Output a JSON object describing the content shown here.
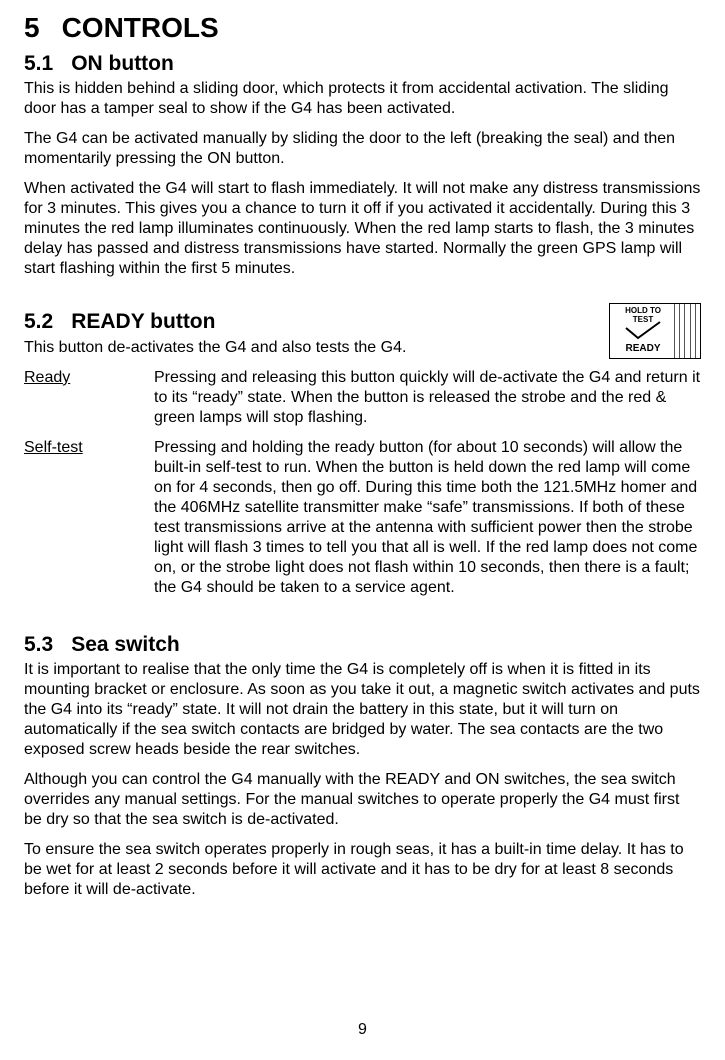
{
  "h1": {
    "num": "5",
    "title": "CONTROLS"
  },
  "s1": {
    "num": "5.1",
    "title": "ON button",
    "p1": "This is hidden behind a sliding door, which protects it from accidental activation. The sliding door has a tamper seal to show if the G4 has been activated.",
    "p2": "The G4 can be activated manually by sliding the door to the left (breaking the seal) and then momentarily pressing the ON button.",
    "p3": "When activated the G4 will start to flash immediately. It will not make any distress transmissions for 3 minutes. This gives you a chance to turn it off if you activated it accidentally. During this 3 minutes the red lamp illuminates continuously. When the red lamp starts to flash, the 3 minutes delay has passed and distress transmissions have started. Normally the green GPS lamp will start flashing within the first 5 minutes."
  },
  "s2": {
    "num": "5.2",
    "title": "READY button",
    "intro": "This button de-activates the G4 and also tests the G4.",
    "diagram": {
      "top": "HOLD TO TEST",
      "bottom": "READY"
    },
    "defs": [
      {
        "term": "Ready",
        "desc": "Pressing and releasing this button quickly will de-activate the G4 and return it to its “ready” state. When the button is released the strobe and the red & green lamps will stop flashing."
      },
      {
        "term": "Self-test",
        "desc": "Pressing and holding the ready button (for about 10 seconds) will allow the built-in self-test to run. When the button is held down the red lamp will come on for 4 seconds, then go off.  During this time both the 121.5MHz homer and the 406MHz satellite transmitter make “safe” transmissions. If both of these test transmissions arrive at the antenna with sufficient power then the strobe light will flash 3 times to tell you that all is well. If the red lamp does not come on, or the strobe light does not flash within 10 seconds, then there is a fault; the G4 should be taken to a service agent."
      }
    ]
  },
  "s3": {
    "num": "5.3",
    "title": "Sea switch",
    "p1": "It is important to realise that the only time the G4 is completely off is when it is fitted in its mounting bracket or enclosure. As soon as you take it out, a magnetic switch activates and puts the G4 into its “ready” state. It will not drain the battery in this state, but it will turn on automatically if the sea switch contacts are bridged by water. The sea contacts are the two exposed screw heads beside the rear switches.",
    "p2": "Although you can control the G4 manually with the READY and ON switches, the sea switch overrides any manual settings. For the manual switches to operate properly the G4 must first be dry so that the sea switch is de-activated.",
    "p3": "To ensure the sea switch operates properly in rough seas, it has a built-in time delay. It has to be wet for at least 2 seconds before it will activate and it has to be dry for at least 8 seconds before it will de-activate."
  },
  "page_number": "9"
}
